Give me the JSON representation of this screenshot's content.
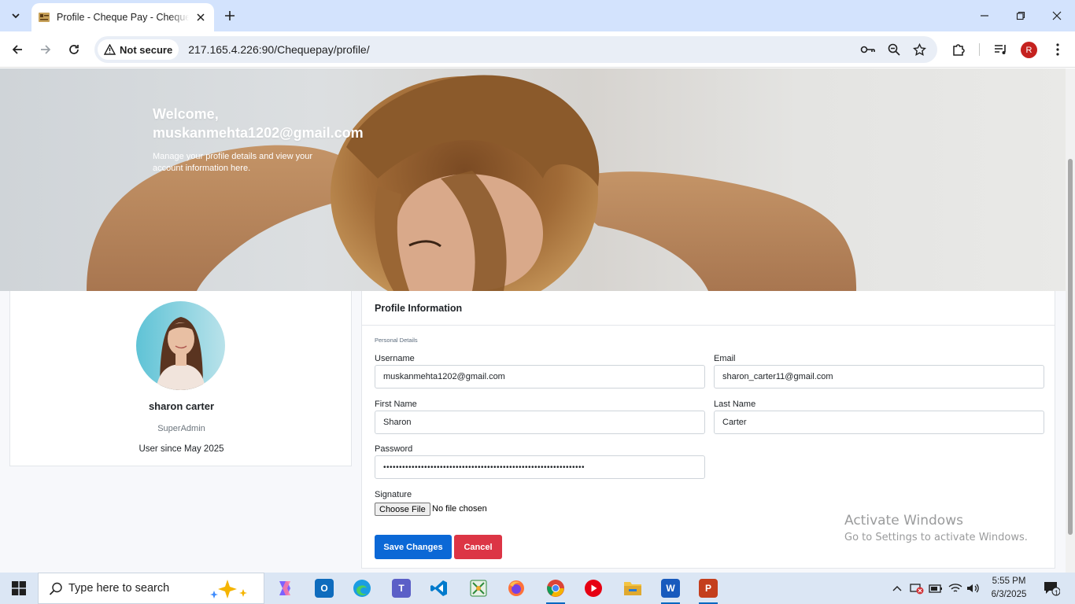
{
  "browser": {
    "tab_title": "Profile - Cheque Pay - Cheque Pay",
    "security_label": "Not secure",
    "url": "217.165.4.226:90/Chequepay/profile/",
    "profile_initial": "R"
  },
  "hero": {
    "welcome": "Welcome,",
    "email": "muskanmehta1202@gmail.com",
    "subtitle": "Manage your profile details and view your account information here."
  },
  "profile_card": {
    "name": "sharon carter",
    "role": "SuperAdmin",
    "since": "User since May 2025"
  },
  "form": {
    "title": "Profile Information",
    "section": "Personal Details",
    "username_label": "Username",
    "username_value": "muskanmehta1202@gmail.com",
    "email_label": "Email",
    "email_value": "sharon_carter11@gmail.com",
    "first_name_label": "First Name",
    "first_name_value": "Sharon",
    "last_name_label": "Last Name",
    "last_name_value": "Carter",
    "password_label": "Password",
    "password_value": "••••••••••••••••••••••••••••••••••••••••••••••••••••••••••••••••",
    "signature_label": "Signature",
    "file_button": "Choose File",
    "file_status": "No file chosen",
    "save_button": "Save Changes",
    "cancel_button": "Cancel"
  },
  "watermark": {
    "line1": "Activate Windows",
    "line2": "Go to Settings to activate Windows."
  },
  "taskbar": {
    "search_placeholder": "Type here to search",
    "time": "5:55 PM",
    "date": "6/3/2025",
    "notification_count": "1"
  },
  "colors": {
    "primary": "#0b68d6",
    "danger": "#dc3545",
    "tabstrip": "#d3e3fd",
    "taskbar": "#dbe6f4"
  }
}
